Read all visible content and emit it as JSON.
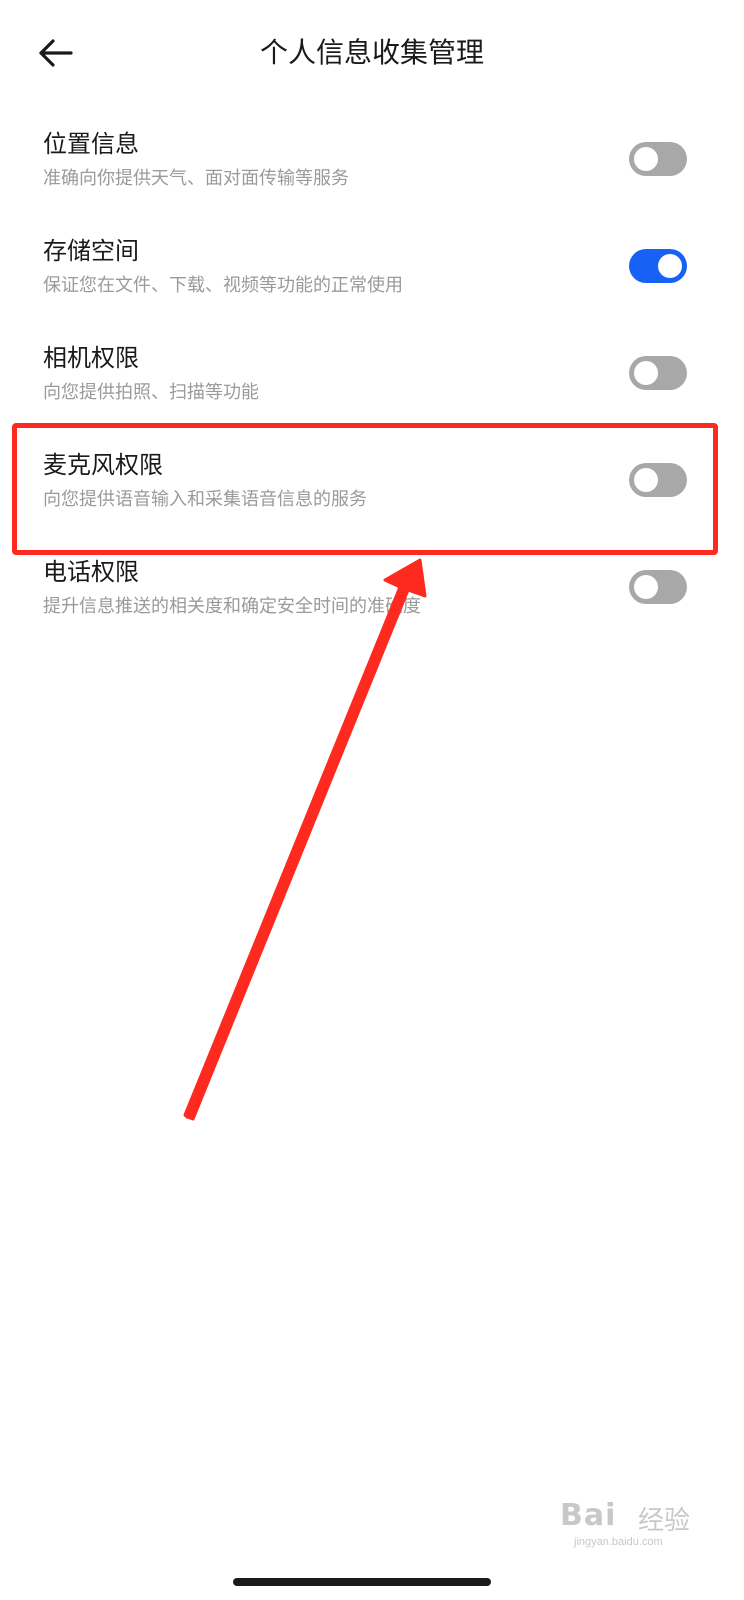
{
  "header": {
    "title": "个人信息收集管理",
    "back_icon": "arrow-left-icon"
  },
  "settings": [
    {
      "title": "位置信息",
      "description": "准确向你提供天气、面对面传输等服务",
      "enabled": false
    },
    {
      "title": "存储空间",
      "description": "保证您在文件、下载、视频等功能的正常使用",
      "enabled": true
    },
    {
      "title": "相机权限",
      "description": "向您提供拍照、扫描等功能",
      "enabled": false
    },
    {
      "title": "麦克风权限",
      "description": "向您提供语音输入和采集语音信息的服务",
      "enabled": false
    },
    {
      "title": "电话权限",
      "description": "提升信息推送的相关度和确定安全时间的准确度",
      "enabled": false
    }
  ],
  "colors": {
    "toggle_on": "#1861f5",
    "toggle_off": "#a8a8a8",
    "annotation": "#ff2a1f"
  },
  "watermark": {
    "brand": "Bai",
    "brand_suffix": "经验",
    "url": "jingyan.baidu.com"
  }
}
